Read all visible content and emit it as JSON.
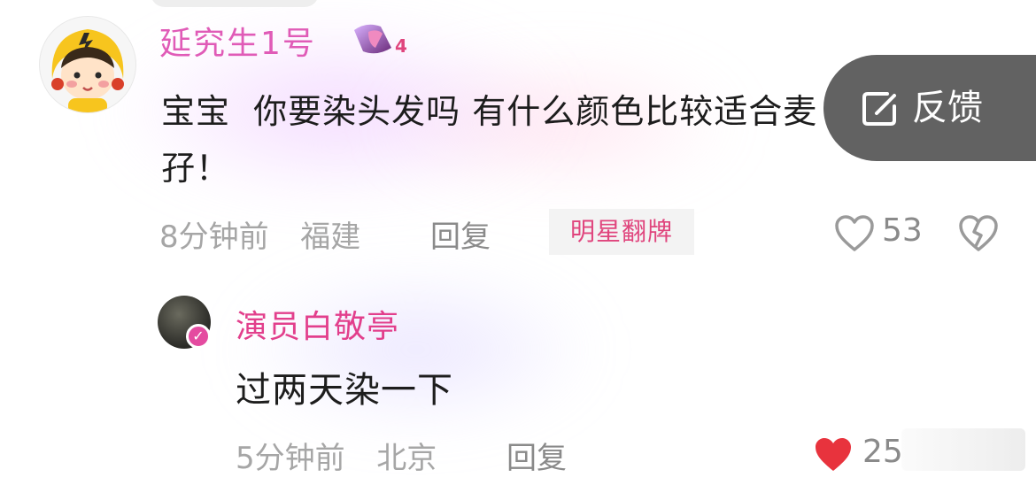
{
  "comment": {
    "username": "延究生1号",
    "level": "4",
    "text": "宝宝  你要染头发吗 有什么颜色比较适合麦孖！",
    "time": "8分钟前",
    "location": "福建",
    "reply_label": "回复",
    "tag": "明星翻牌",
    "likes": "53"
  },
  "reply": {
    "username": "演员白敬亭",
    "text": "过两天染一下",
    "time": "5分钟前",
    "location": "北京",
    "reply_label": "回复",
    "likes": "25"
  },
  "feedback": {
    "label": "反馈"
  },
  "colors": {
    "username_pink": "#e05bb7",
    "reply_username": "#e23f8c",
    "tag_text": "#e0457d",
    "liked_heart": "#e8333d",
    "feedback_bg": "#555555"
  }
}
